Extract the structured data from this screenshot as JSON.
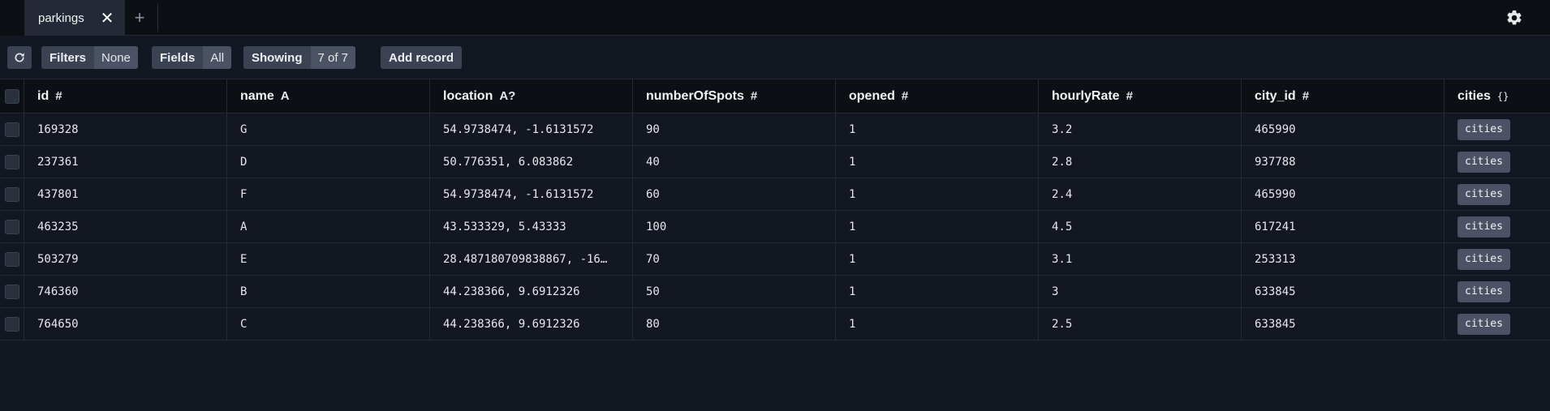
{
  "tabs": [
    {
      "label": "parkings"
    }
  ],
  "toolbar": {
    "filters_label": "Filters",
    "filters_value": "None",
    "fields_label": "Fields",
    "fields_value": "All",
    "showing_label": "Showing",
    "showing_value": "7 of 7",
    "add_record_label": "Add record"
  },
  "columns": [
    {
      "name": "id",
      "type": "#"
    },
    {
      "name": "name",
      "type": "A"
    },
    {
      "name": "location",
      "type": "A?"
    },
    {
      "name": "numberOfSpots",
      "type": "#"
    },
    {
      "name": "opened",
      "type": "#"
    },
    {
      "name": "hourlyRate",
      "type": "#"
    },
    {
      "name": "city_id",
      "type": "#"
    },
    {
      "name": "cities",
      "type": "{}"
    }
  ],
  "rows": [
    {
      "id": "169328",
      "name": "G",
      "location": "54.9738474, -1.6131572",
      "numberOfSpots": "90",
      "opened": "1",
      "hourlyRate": "3.2",
      "city_id": "465990",
      "cities": "cities"
    },
    {
      "id": "237361",
      "name": "D",
      "location": "50.776351, 6.083862",
      "numberOfSpots": "40",
      "opened": "1",
      "hourlyRate": "2.8",
      "city_id": "937788",
      "cities": "cities"
    },
    {
      "id": "437801",
      "name": "F",
      "location": "54.9738474, -1.6131572",
      "numberOfSpots": "60",
      "opened": "1",
      "hourlyRate": "2.4",
      "city_id": "465990",
      "cities": "cities"
    },
    {
      "id": "463235",
      "name": "A",
      "location": "43.533329, 5.43333",
      "numberOfSpots": "100",
      "opened": "1",
      "hourlyRate": "4.5",
      "city_id": "617241",
      "cities": "cities"
    },
    {
      "id": "503279",
      "name": "E",
      "location": "28.487180709838867, -16…",
      "numberOfSpots": "70",
      "opened": "1",
      "hourlyRate": "3.1",
      "city_id": "253313",
      "cities": "cities"
    },
    {
      "id": "746360",
      "name": "B",
      "location": "44.238366, 9.6912326",
      "numberOfSpots": "50",
      "opened": "1",
      "hourlyRate": "3",
      "city_id": "633845",
      "cities": "cities"
    },
    {
      "id": "764650",
      "name": "C",
      "location": "44.238366, 9.6912326",
      "numberOfSpots": "80",
      "opened": "1",
      "hourlyRate": "2.5",
      "city_id": "633845",
      "cities": "cities"
    }
  ]
}
